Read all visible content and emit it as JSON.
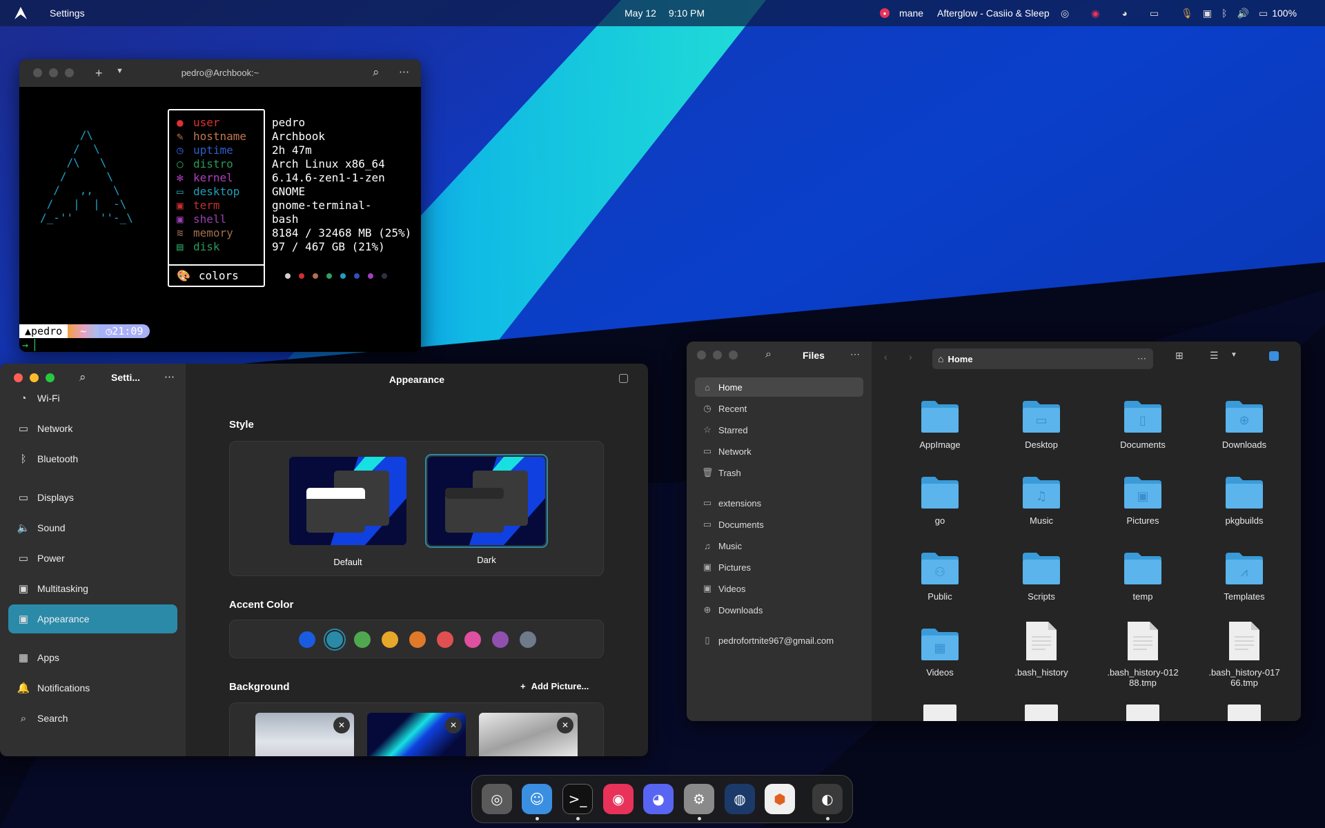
{
  "colors": {
    "accent": "#2a8aa8",
    "term_user": "#e03030",
    "term_host": "#c07850",
    "term_uptime": "#2f5fc8",
    "term_distro": "#2a9a5a",
    "term_kernel": "#b040c0",
    "term_desktop": "#20a0b8",
    "term_term": "#c03030",
    "term_shell": "#9a40b0",
    "term_memory": "#a07050",
    "term_disk": "#2a9a5a"
  },
  "topbar": {
    "app_name": "Settings",
    "date": "May 12",
    "time": "9:10 PM",
    "user": "mane",
    "now_playing": "Afterglow - Casiio & Sleep",
    "battery": "100%"
  },
  "terminal": {
    "title": "pedro@Archbook:~",
    "ascii": [
      "      /\\",
      "     /  \\",
      "    /\\   \\",
      "   /      \\",
      "  /   ,,   \\",
      " /   |  |  -\\",
      "/_-''    ''-_\\"
    ],
    "info": [
      {
        "key": "user",
        "value": "pedro",
        "color": "#e03030"
      },
      {
        "key": "hostname",
        "value": "Archbook",
        "color": "#c07850"
      },
      {
        "key": "uptime",
        "value": "2h 47m",
        "color": "#2f5fc8"
      },
      {
        "key": "distro",
        "value": "Arch Linux x86_64",
        "color": "#2a9a5a"
      },
      {
        "key": "kernel",
        "value": "6.14.6-zen1-1-zen",
        "color": "#b040c0"
      },
      {
        "key": "desktop",
        "value": "GNOME",
        "color": "#20a0b8"
      },
      {
        "key": "term",
        "value": "gnome-terminal-",
        "color": "#c03030"
      },
      {
        "key": "shell",
        "value": "bash",
        "color": "#9a40b0"
      },
      {
        "key": "memory",
        "value": "8184 / 32468 MB (25%)",
        "color": "#a07050"
      },
      {
        "key": "disk",
        "value": "97 / 467 GB (21%)",
        "color": "#2a9a5a"
      }
    ],
    "colors_label": "colors",
    "palette": [
      "#d0d0d0",
      "#d03030",
      "#b07050",
      "#30a060",
      "#20a0c0",
      "#3050c0",
      "#a040c0",
      "#303040"
    ],
    "prompt_user": "pedro",
    "prompt_dir": "~",
    "prompt_time": "21:09"
  },
  "settings": {
    "title": "Setti...",
    "page_title": "Appearance",
    "sidebar": [
      {
        "label": "Wi-Fi",
        "icon": "wifi-icon",
        "glyph": "◔"
      },
      {
        "label": "Network",
        "icon": "network-icon",
        "glyph": "▭"
      },
      {
        "label": "Bluetooth",
        "icon": "bluetooth-icon",
        "glyph": "ᛒ"
      },
      {
        "label": "Displays",
        "icon": "display-icon",
        "glyph": "▭"
      },
      {
        "label": "Sound",
        "icon": "sound-icon",
        "glyph": "🔈"
      },
      {
        "label": "Power",
        "icon": "power-icon",
        "glyph": "▭"
      },
      {
        "label": "Multitasking",
        "icon": "multitasking-icon",
        "glyph": "▣"
      },
      {
        "label": "Appearance",
        "icon": "appearance-icon",
        "glyph": "▣"
      },
      {
        "label": "Apps",
        "icon": "apps-icon",
        "glyph": "▦"
      },
      {
        "label": "Notifications",
        "icon": "bell-icon",
        "glyph": "🔔"
      },
      {
        "label": "Search",
        "icon": "search-icon",
        "glyph": "⌕"
      }
    ],
    "style_heading": "Style",
    "style_options": [
      "Default",
      "Dark"
    ],
    "accent_heading": "Accent Color",
    "accent_colors": [
      "#1a5ce0",
      "#2a8aa8",
      "#4fa84f",
      "#e6a82a",
      "#e07a2a",
      "#e05050",
      "#e050a0",
      "#9050b0",
      "#6f7a8a"
    ],
    "background_heading": "Background",
    "add_picture": "Add Picture..."
  },
  "files": {
    "title": "Files",
    "location": "Home",
    "sidebar": [
      {
        "label": "Home",
        "icon": "home-icon",
        "glyph": "⌂"
      },
      {
        "label": "Recent",
        "icon": "clock-icon",
        "glyph": "◷"
      },
      {
        "label": "Starred",
        "icon": "star-icon",
        "glyph": "☆"
      },
      {
        "label": "Network",
        "icon": "network-icon",
        "glyph": "▭"
      },
      {
        "label": "Trash",
        "icon": "trash-icon",
        "glyph": "🗑"
      }
    ],
    "bookmarks": [
      {
        "label": "extensions",
        "icon": "folder-icon",
        "glyph": "▭"
      },
      {
        "label": "Documents",
        "icon": "document-icon",
        "glyph": "▭"
      },
      {
        "label": "Music",
        "icon": "music-icon",
        "glyph": "♫"
      },
      {
        "label": "Pictures",
        "icon": "picture-icon",
        "glyph": "▣"
      },
      {
        "label": "Videos",
        "icon": "video-icon",
        "glyph": "▣"
      },
      {
        "label": "Downloads",
        "icon": "download-icon",
        "glyph": "⊕"
      }
    ],
    "account": "pedrofortnite967@gmail.com",
    "items": [
      {
        "name": "AppImage",
        "type": "folder",
        "emblem": ""
      },
      {
        "name": "Desktop",
        "type": "folder",
        "emblem": "▭"
      },
      {
        "name": "Documents",
        "type": "folder",
        "emblem": "▯"
      },
      {
        "name": "Downloads",
        "type": "folder",
        "emblem": "⊕"
      },
      {
        "name": "go",
        "type": "folder",
        "emblem": ""
      },
      {
        "name": "Music",
        "type": "folder",
        "emblem": "♫"
      },
      {
        "name": "Pictures",
        "type": "folder",
        "emblem": "▣"
      },
      {
        "name": "pkgbuilds",
        "type": "folder",
        "emblem": ""
      },
      {
        "name": "Public",
        "type": "folder",
        "emblem": "⚇"
      },
      {
        "name": "Scripts",
        "type": "folder",
        "emblem": ""
      },
      {
        "name": "temp",
        "type": "folder",
        "emblem": ""
      },
      {
        "name": "Templates",
        "type": "folder",
        "emblem": "⩘"
      },
      {
        "name": "Videos",
        "type": "folder",
        "emblem": "▦"
      },
      {
        "name": ".bash_history",
        "type": "file",
        "emblem": ""
      },
      {
        "name": ".bash_history-01288.tmp",
        "type": "file",
        "emblem": ""
      },
      {
        "name": ".bash_history-01766.tmp",
        "type": "file",
        "emblem": ""
      }
    ]
  },
  "dock": [
    {
      "name": "gnome-tweaks",
      "color": "#5a5a5a",
      "glyph": "◎",
      "running": false
    },
    {
      "name": "finder",
      "color": "#3a8fe0",
      "glyph": "☺",
      "running": true
    },
    {
      "name": "terminal",
      "color": "#111111",
      "glyph": ">_",
      "running": true
    },
    {
      "name": "music-player",
      "color": "#e8325a",
      "glyph": "◉",
      "running": false
    },
    {
      "name": "discord",
      "color": "#5865f2",
      "glyph": "◕",
      "running": false
    },
    {
      "name": "settings",
      "color": "#8a8a8a",
      "glyph": "⚙",
      "running": true
    },
    {
      "name": "steam",
      "color": "#1b3a6a",
      "glyph": "◍",
      "running": false
    },
    {
      "name": "colors-app",
      "color": "#f0f0f0",
      "glyph": "⬢",
      "running": false
    },
    {
      "name": "obs",
      "color": "#3a3a3a",
      "glyph": "◐",
      "running": true
    }
  ]
}
